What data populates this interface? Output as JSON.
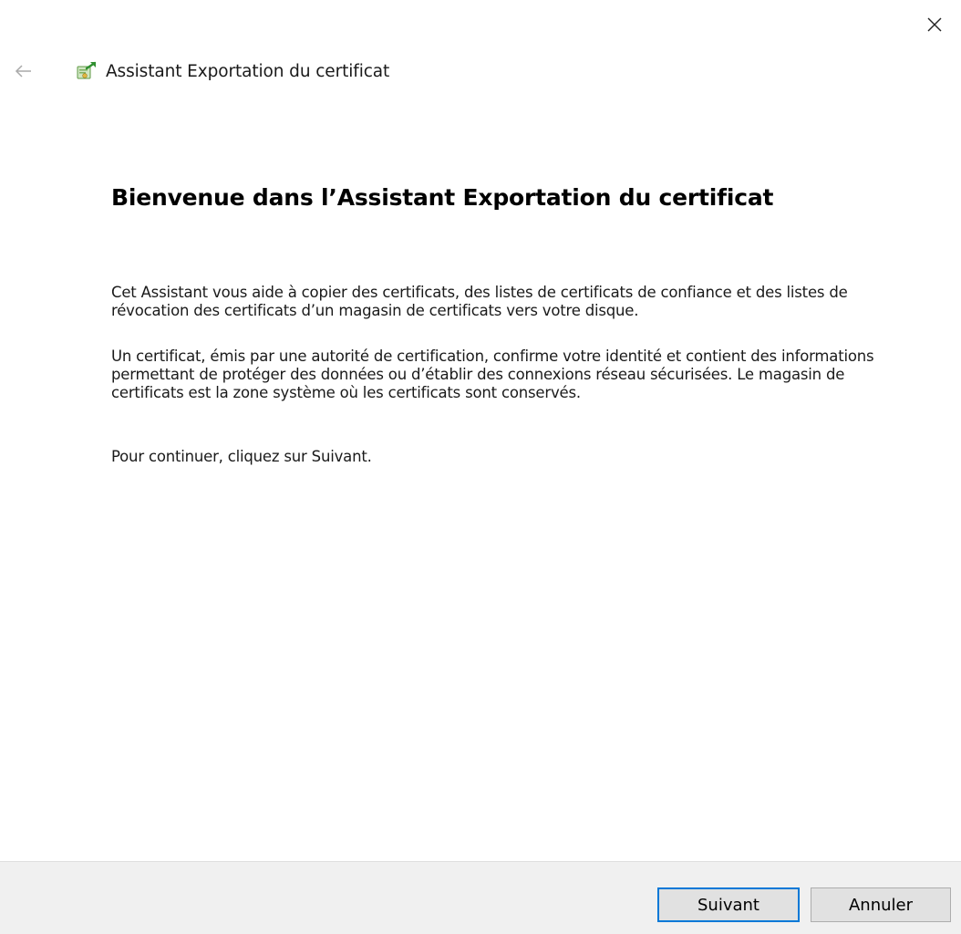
{
  "window": {
    "close_icon": "close-icon"
  },
  "header": {
    "back_icon": "back-arrow-icon",
    "wizard_icon": "certificate-wizard-icon",
    "title": "Assistant Exportation du certificat"
  },
  "main": {
    "heading": "Bienvenue dans l’Assistant Exportation du certificat",
    "paragraphs": [
      "Cet Assistant vous aide à copier des certificats, des listes de certificats de confiance et des listes de révocation des certificats d’un magasin de certificats vers votre disque.",
      "Un certificat, émis par une autorité de certification, confirme votre identité et contient des informations permettant de protéger des données ou d’établir des connexions réseau sécurisées. Le magasin de certificats est la zone système où les certificats sont conservés.",
      "Pour continuer, cliquez sur Suivant."
    ]
  },
  "footer": {
    "next_label": "Suivant",
    "cancel_label": "Annuler"
  },
  "colors": {
    "accent": "#0078d7",
    "footer_bg": "#f0f0f0",
    "button_bg": "#e1e1e1"
  }
}
